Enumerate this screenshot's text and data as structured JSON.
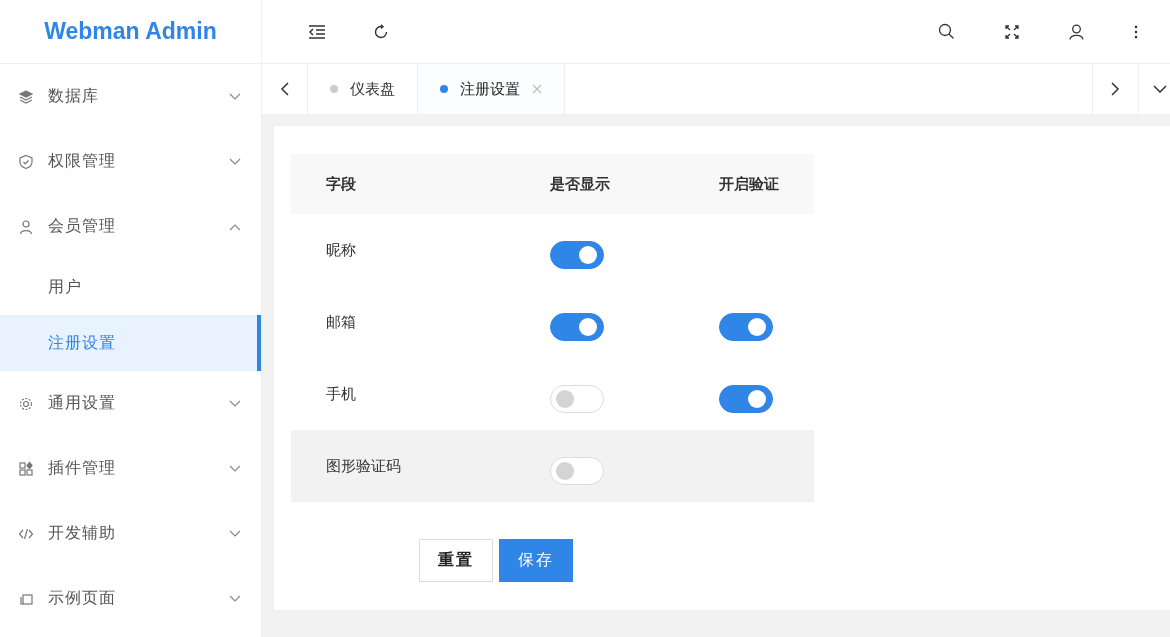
{
  "logo": "Webman Admin",
  "sidebar": {
    "items": [
      {
        "label": "数据库",
        "expanded": false
      },
      {
        "label": "权限管理",
        "expanded": false
      },
      {
        "label": "会员管理",
        "expanded": true,
        "children": [
          {
            "label": "用户",
            "selected": false
          },
          {
            "label": "注册设置",
            "selected": true
          }
        ]
      },
      {
        "label": "通用设置",
        "expanded": false
      },
      {
        "label": "插件管理",
        "expanded": false
      },
      {
        "label": "开发辅助",
        "expanded": false
      },
      {
        "label": "示例页面",
        "expanded": false
      }
    ]
  },
  "tabs": [
    {
      "label": "仪表盘",
      "selected": false,
      "closable": false
    },
    {
      "label": "注册设置",
      "selected": true,
      "closable": true
    }
  ],
  "table": {
    "columns": [
      "字段",
      "是否显示",
      "开启验证"
    ],
    "rows": [
      {
        "field": "昵称",
        "show": true,
        "hovered": false
      },
      {
        "field": "邮箱",
        "show": true,
        "verify": true,
        "hovered": false
      },
      {
        "field": "手机",
        "show": false,
        "verify": true,
        "hovered": false
      },
      {
        "field": "图形验证码",
        "show": false,
        "hovered": true
      }
    ]
  },
  "buttons": [
    "重置",
    "保存"
  ]
}
